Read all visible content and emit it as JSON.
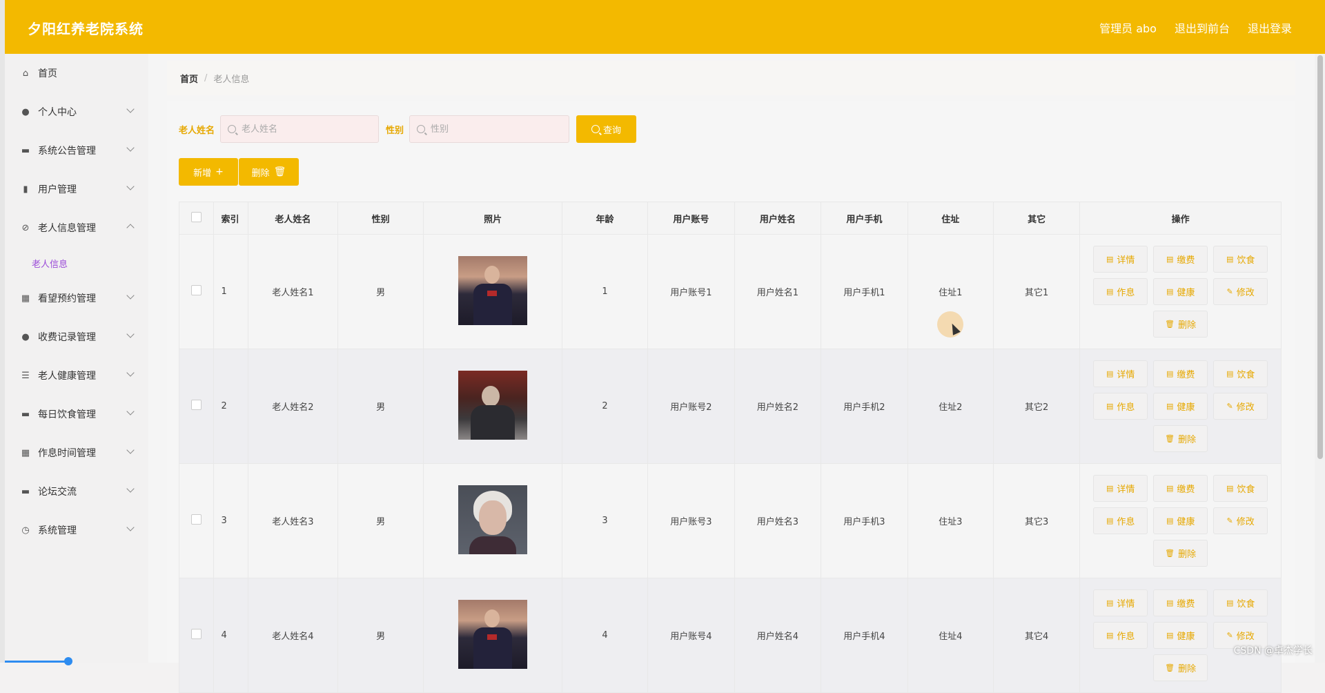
{
  "app": {
    "title": "夕阳红养老院系统"
  },
  "header": {
    "user": "管理员 abo",
    "front": "退出到前台",
    "logout": "退出登录"
  },
  "sidebar": {
    "items": [
      {
        "label": "首页",
        "icon": "home-icon",
        "expandable": false
      },
      {
        "label": "个人中心",
        "icon": "user-icon",
        "expandable": true
      },
      {
        "label": "系统公告管理",
        "icon": "briefcase-icon",
        "expandable": true
      },
      {
        "label": "用户管理",
        "icon": "users-icon",
        "expandable": true
      },
      {
        "label": "老人信息管理",
        "icon": "bell-off-icon",
        "expandable": true,
        "open": true,
        "children": [
          {
            "label": "老人信息"
          }
        ]
      },
      {
        "label": "看望预约管理",
        "icon": "grid-icon",
        "expandable": true
      },
      {
        "label": "收费记录管理",
        "icon": "person-icon",
        "expandable": true
      },
      {
        "label": "老人健康管理",
        "icon": "list-icon",
        "expandable": true
      },
      {
        "label": "每日饮食管理",
        "icon": "chat-icon",
        "expandable": true
      },
      {
        "label": "作息时间管理",
        "icon": "apps-icon",
        "expandable": true
      },
      {
        "label": "论坛交流",
        "icon": "monitor-icon",
        "expandable": true
      },
      {
        "label": "系统管理",
        "icon": "clock-icon",
        "expandable": true
      }
    ]
  },
  "breadcrumb": {
    "home": "首页",
    "sep": "/",
    "current": "老人信息"
  },
  "search": {
    "name_label": "老人姓名",
    "name_placeholder": "老人姓名",
    "gender_label": "性别",
    "gender_placeholder": "性别",
    "query": "查询"
  },
  "actions": {
    "add": "新增",
    "delete": "删除"
  },
  "table": {
    "headers": [
      "索引",
      "老人姓名",
      "性别",
      "照片",
      "年龄",
      "用户账号",
      "用户姓名",
      "用户手机",
      "住址",
      "其它",
      "操作"
    ],
    "rows": [
      {
        "index": "1",
        "name": "老人姓名1",
        "gender": "男",
        "photo": "ph1",
        "age": "1",
        "account": "用户账号1",
        "uname": "用户姓名1",
        "phone": "用户手机1",
        "addr": "住址1",
        "other": "其它1"
      },
      {
        "index": "2",
        "name": "老人姓名2",
        "gender": "男",
        "photo": "ph2",
        "age": "2",
        "account": "用户账号2",
        "uname": "用户姓名2",
        "phone": "用户手机2",
        "addr": "住址2",
        "other": "其它2"
      },
      {
        "index": "3",
        "name": "老人姓名3",
        "gender": "男",
        "photo": "ph3",
        "age": "3",
        "account": "用户账号3",
        "uname": "用户姓名3",
        "phone": "用户手机3",
        "addr": "住址3",
        "other": "其它3"
      },
      {
        "index": "4",
        "name": "老人姓名4",
        "gender": "男",
        "photo": "ph1",
        "age": "4",
        "account": "用户账号4",
        "uname": "用户姓名4",
        "phone": "用户手机4",
        "addr": "住址4",
        "other": "其它4"
      }
    ],
    "ops": [
      "详情",
      "缴费",
      "饮食",
      "作息",
      "健康",
      "修改",
      "删除"
    ]
  },
  "colors": {
    "primary": "#f3b900",
    "accent_text": "#e6a800",
    "submenu": "#9b4bd8"
  },
  "watermark": "CSDN @卓杰学长"
}
